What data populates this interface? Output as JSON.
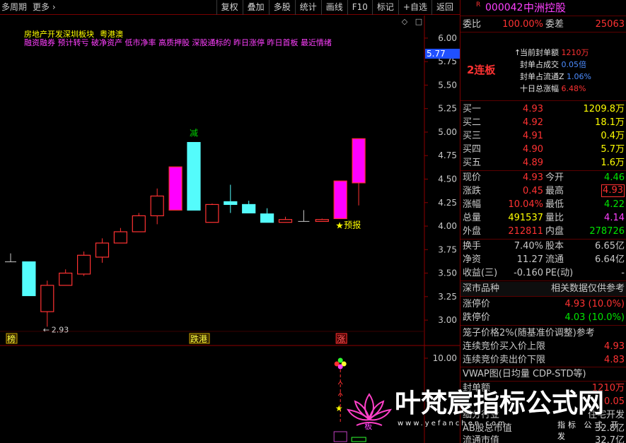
{
  "topbar": {
    "period_label": "多周期",
    "more_label": "更多",
    "more_icon": "chevron-right-icon",
    "buttons": [
      "复权",
      "叠加",
      "多股",
      "统计",
      "画线",
      "F10",
      "标记",
      "+自选",
      "返回"
    ]
  },
  "annotations": {
    "line1": [
      "房地产开发深圳板块",
      "粤港澳"
    ],
    "line2": "融资融券 预计转亏 破净资产 低市净率 高质押股 深股通标的 昨日涨停 昨日首板 最近情绪"
  },
  "cursor_value": "5.77",
  "colors": {
    "up": "#ff3232",
    "down": "#54fcfc",
    "limit_up_fill": "#ff00ff",
    "doji": "#c8c8c8",
    "axis": "#8b0000",
    "axis_text": "#c8c8c8",
    "marker_green": "#00d000",
    "marker_yellow": "#ffff00"
  },
  "chart_data": {
    "type": "candlestick",
    "fields": [
      "open",
      "high",
      "low",
      "close"
    ],
    "candles": [
      [
        3.62,
        3.71,
        3.62,
        3.62
      ],
      [
        3.62,
        3.62,
        3.26,
        3.26
      ],
      [
        3.09,
        3.42,
        2.93,
        3.37
      ],
      [
        3.37,
        3.54,
        3.37,
        3.5
      ],
      [
        3.49,
        3.73,
        3.47,
        3.69
      ],
      [
        3.67,
        3.87,
        3.61,
        3.82
      ],
      [
        3.82,
        3.98,
        3.82,
        3.94
      ],
      [
        3.94,
        4.14,
        3.94,
        4.11
      ],
      [
        4.11,
        4.4,
        4.02,
        4.32
      ],
      [
        4.17,
        4.63,
        4.17,
        4.63
      ],
      [
        4.89,
        4.89,
        4.17,
        4.17
      ],
      [
        4.04,
        4.24,
        4.04,
        4.23
      ],
      [
        4.26,
        4.44,
        4.14,
        4.23
      ],
      [
        4.23,
        4.27,
        4.14,
        4.14
      ],
      [
        4.13,
        4.19,
        4.04,
        4.04
      ],
      [
        4.04,
        4.1,
        4.04,
        4.07
      ],
      [
        4.05,
        4.17,
        4.05,
        4.05
      ],
      [
        4.05,
        4.08,
        4.05,
        4.07
      ],
      [
        4.08,
        4.48,
        4.08,
        4.48
      ],
      [
        4.46,
        4.93,
        4.22,
        4.93
      ]
    ],
    "highlight_candles": [
      9,
      18,
      19
    ],
    "y_ticks": [
      "6.00",
      "5.75",
      "5.50",
      "5.25",
      "5.00",
      "4.75",
      "4.50",
      "4.25",
      "4.00",
      "3.75",
      "3.50",
      "3.25",
      "3.00"
    ],
    "ylim": [
      2.73,
      6.24
    ],
    "markers": {
      "low_label": {
        "candle": 2,
        "text": "2.93"
      },
      "above_label": {
        "candle": 10,
        "text": "减"
      },
      "forecast_label": {
        "candle": 18,
        "text": "预报"
      },
      "strip_labels": [
        {
          "candle": 0,
          "text": "榜"
        },
        {
          "candle": 10,
          "text": "跌港"
        },
        {
          "candle": 18,
          "text": "涨"
        }
      ]
    },
    "volume_pane": {
      "y_ticks": [
        "10.00"
      ],
      "label": "板"
    }
  },
  "quote": {
    "header": {
      "badge": "R",
      "code": "000042",
      "name": "中洲控股"
    },
    "weibi": {
      "label": "委比",
      "value": "100.00%",
      "label2": "委差",
      "value2": "25063"
    },
    "seal": {
      "title": "2连板",
      "rows": [
        {
          "label": "当前封单额",
          "value": "1210万"
        },
        {
          "label": "封单占成交",
          "value": "0.05倍"
        },
        {
          "label": "封单占流通Z",
          "value": "1.06%"
        },
        {
          "label": "十日总涨幅",
          "value": "6.48%"
        }
      ]
    },
    "bids": [
      {
        "label": "买一",
        "price": "4.93",
        "vol": "1209.8万"
      },
      {
        "label": "买二",
        "price": "4.92",
        "vol": "18.1万"
      },
      {
        "label": "买三",
        "price": "4.91",
        "vol": "0.4万"
      },
      {
        "label": "买四",
        "price": "4.90",
        "vol": "5.7万"
      },
      {
        "label": "买五",
        "price": "4.89",
        "vol": "1.6万"
      }
    ],
    "stats": [
      {
        "l1": "现价",
        "v1": "4.93",
        "l2": "今开",
        "v2": "4.46"
      },
      {
        "l1": "涨跌",
        "v1": "0.45",
        "l2": "最高",
        "v2": "4.93"
      },
      {
        "l1": "涨幅",
        "v1": "10.04%",
        "l2": "最低",
        "v2": "4.22"
      },
      {
        "l1": "总量",
        "v1": "491537",
        "l2": "量比",
        "v2": "4.14"
      },
      {
        "l1": "外盘",
        "v1": "212811",
        "l2": "内盘",
        "v2": "278726"
      }
    ],
    "fin": [
      {
        "l1": "换手",
        "v1": "7.40%",
        "l2": "股本",
        "v2": "6.65亿"
      },
      {
        "l1": "净资",
        "v1": "11.27",
        "l2": "流通",
        "v2": "6.64亿"
      },
      {
        "l1": "收益(三)",
        "v1": "-0.160",
        "l2": "PE(动)",
        "v2": "-"
      }
    ],
    "market": {
      "label": "深市品种",
      "note": "相关数据仅供参考"
    },
    "limits": [
      {
        "label": "涨停价",
        "value": "4.93 (10.0%)"
      },
      {
        "label": "跌停价",
        "value": "4.03 (10.0%)"
      }
    ],
    "cage": {
      "title": "笼子价格2%(随基准价调整)参考",
      "rows": [
        {
          "label": "连续竞价买入价上限",
          "value": "4.93"
        },
        {
          "label": "连续竞价卖出价下限",
          "value": "4.83"
        }
      ]
    },
    "vwap": "VWAP图(日均量 CDP-STD等)",
    "extra": [
      {
        "label": "封单额",
        "value": "1210万"
      },
      {
        "label": "",
        "value": "0.05"
      },
      {
        "label": "细分行业",
        "value": "住宅开发"
      },
      {
        "label": "AB股总市值",
        "value": "32.8亿"
      },
      {
        "label": "流通市值",
        "value": "32.7亿"
      }
    ]
  },
  "watermark": {
    "title": "叶梵宸指标公式网",
    "url": "www.yefanchen.com",
    "tagline": "指标 公式 开发"
  }
}
